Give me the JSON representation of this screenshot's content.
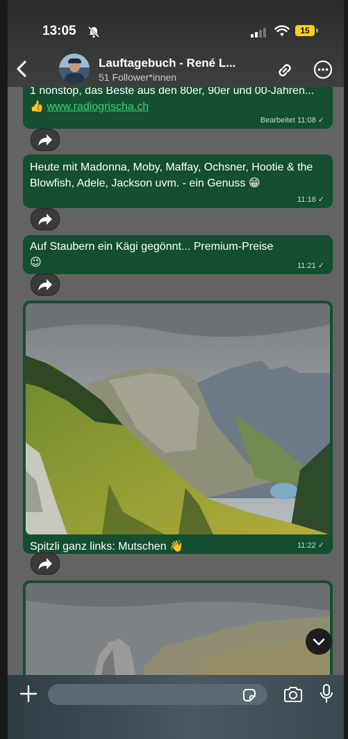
{
  "status_bar": {
    "time": "13:05",
    "battery": "15"
  },
  "header": {
    "title": "Lauftagebuch - René L...",
    "subtitle": "51 Follower*innen"
  },
  "messages": [
    {
      "text_prefix": "1 nonstop, das Beste aus den 80er, 90er und 00-Jahren... 👍 ",
      "link": "www.radiogrischa.ch",
      "edited_label": "Bearbeitet",
      "time": "11:08"
    },
    {
      "text": "Heute mit Madonna, Moby, Maffay, Ochsner, Hootie & the Blowfish, Adele, Jackson uvm. - ein Genuss 😁",
      "time": "11:18"
    },
    {
      "text": "Auf Staubern ein Kägi gegönnt... Premium-Preise 😉",
      "time": "11:21"
    },
    {
      "caption": "Spitzli ganz links: Mutschen 👋",
      "time": "11:22"
    }
  ],
  "icons": {
    "back": "chevron-left-icon",
    "link": "link-icon",
    "more": "more-options-icon",
    "forward": "forward-icon",
    "scroll_down": "chevron-down-icon",
    "add": "plus-icon",
    "sticker": "sticker-icon",
    "camera": "camera-icon",
    "mic": "microphone-icon"
  },
  "colors": {
    "bubble": "#144f31",
    "link": "#39d47c",
    "battery": "#f2d21c"
  }
}
